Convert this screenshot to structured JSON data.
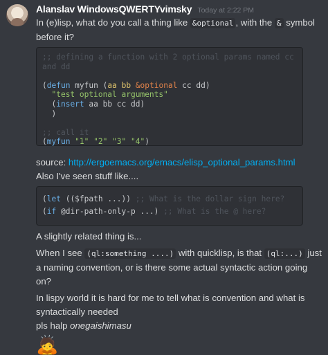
{
  "author": {
    "name": "Alanslav WindowsQWERTYvimsky",
    "timestamp": "Today at 2:22 PM"
  },
  "line1": {
    "pre": "In (e)lisp, what do you call a thing like ",
    "code1": "&optional",
    "mid": ", with the ",
    "code2": "&",
    "post": " symbol before it?"
  },
  "code1": {
    "c1": ";; defining a function with 2 optional params named cc",
    "c2": "and dd",
    "l1": {
      "p0": "(",
      "defun": "defun",
      "name": " myfun ",
      "p1": "(",
      "aa": "aa",
      "sp1": " ",
      "bb": "bb",
      "sp2": " ",
      "opt": "&optional",
      "rest": " cc dd)"
    },
    "l2": "\"test optional arguments\"",
    "l3": {
      "p0": "(",
      "fn": "insert",
      "rest": " aa bb cc dd)"
    },
    "l4": ")",
    "c3": ";; call it",
    "l5": {
      "p0": "(",
      "fn": "myfun",
      "s1": " \"1\"",
      "s2": " \"2\"",
      "s3": " \"3\"",
      "s4": " \"4\"",
      "close": ")"
    }
  },
  "source": {
    "label": "source: ",
    "url": "http://ergoemacs.org/emacs/elisp_optional_params.html"
  },
  "also": "Also I've seen stuff like....",
  "code2": {
    "l1": {
      "p0": "(",
      "let": "let",
      "mid": " (($fpath ...)) ",
      "comment": ";; What is the dollar sign here?"
    },
    "l2": {
      "p0": "(",
      "if": "if",
      "mid": " @dir-path-only-p ...) ",
      "comment": ";; What is the @ here?"
    }
  },
  "related": "A slightly related thing is...",
  "when": {
    "pre": "When I see ",
    "code1": "(ql:something ....)",
    "mid": " with quicklisp, is that ",
    "code2": "(ql:...)",
    "post": " just a naming convention, or is there some actual syntactic action going on?"
  },
  "lispy": "In lispy world it is hard for me to tell what is convention and what is syntactically needed",
  "halp": {
    "pre": "pls halp ",
    "em": "onegaishimasu"
  },
  "emoji": "🙇"
}
